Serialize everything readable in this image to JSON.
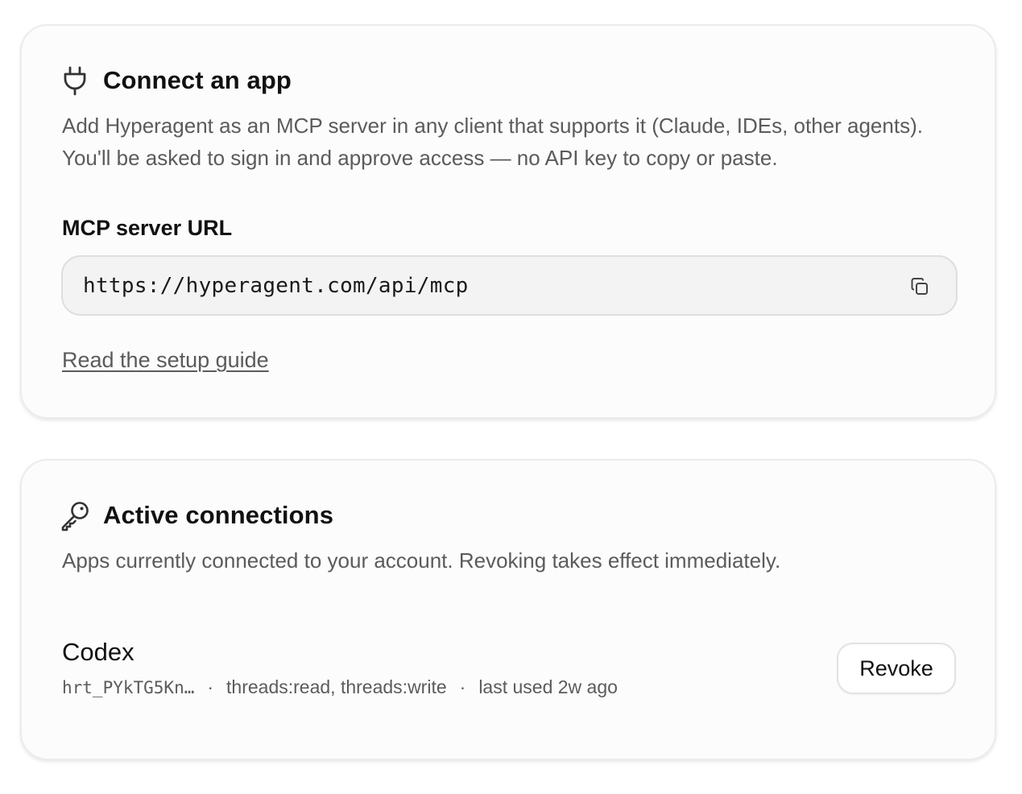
{
  "connect_card": {
    "icon": "plug-icon",
    "title": "Connect an app",
    "description": "Add Hyperagent as an MCP server in any client that supports it (Claude, IDEs, other agents). You'll be asked to sign in and approve access — no API key to copy or paste.",
    "url_label": "MCP server URL",
    "url_value": "https://hyperagent.com/api/mcp",
    "copy_icon": "copy-icon",
    "setup_link": "Read the setup guide"
  },
  "active_card": {
    "icon": "key-icon",
    "title": "Active connections",
    "description": "Apps currently connected to your account. Revoking takes effect immediately.",
    "connections": [
      {
        "name": "Codex",
        "token": "hrt_PYkTG5Kn…",
        "separator": "·",
        "scopes": "threads:read, threads:write",
        "last_used": "last used 2w ago",
        "action_label": "Revoke"
      }
    ]
  }
}
